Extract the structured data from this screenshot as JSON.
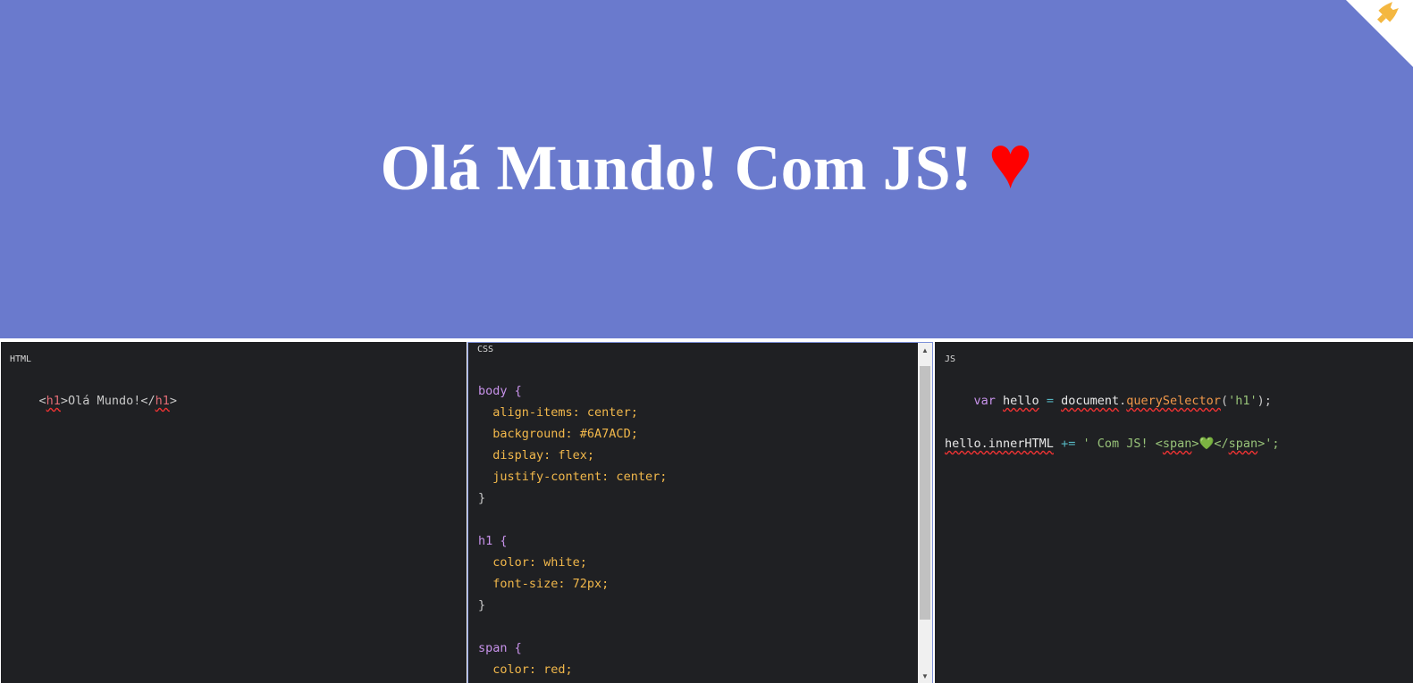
{
  "preview": {
    "heading_text": "Olá Mundo! Com JS!",
    "heart": "♥",
    "background": "#6A7ACD",
    "corner_icon": "cat-icon"
  },
  "editors": {
    "html": {
      "label": "HTML",
      "lines": [
        [
          "<",
          "h1",
          ">Olá Mundo!</",
          "h1",
          ">"
        ]
      ]
    },
    "css": {
      "label": "CSS",
      "lines": [
        "body {",
        "align-items: center;",
        "background: #6A7ACD;",
        "display: flex;",
        "justify-content: center;",
        "}",
        "h1 {",
        "color: white;",
        "font-size: 72px;",
        "}",
        "span {",
        "color: red;"
      ]
    },
    "js": {
      "label": "JS",
      "line1": [
        "var",
        "hello",
        "=",
        "document",
        ".",
        "querySelector",
        "(",
        "'h1'",
        ");"
      ],
      "line2": [
        "hello.innerHTML",
        "+=",
        "' Com JS! <",
        "span",
        ">💚</",
        "span",
        ">';"
      ]
    }
  }
}
